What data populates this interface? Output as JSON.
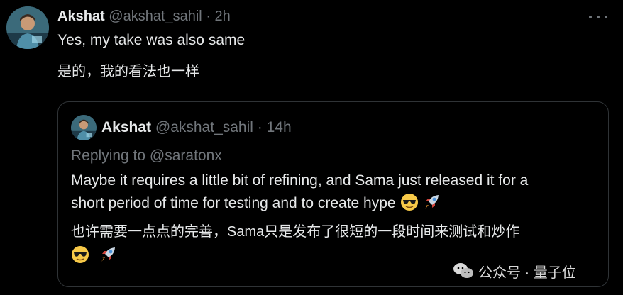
{
  "tweet": {
    "author_name": "Akshat",
    "author_handle": "@akshat_sahil",
    "separator": "·",
    "time": "2h",
    "text_en": "Yes, my take was also same",
    "text_cn": "是的，我的看法也一样",
    "avatar_icon": "avatar-icon",
    "more_icon": "more-icon"
  },
  "quoted": {
    "author_name": "Akshat",
    "author_handle": "@akshat_sahil",
    "separator": "·",
    "time": "14h",
    "replying_to": "Replying to @saratonx",
    "body_line1": "Maybe it requires a little bit of refining, and Sama just released it for a",
    "body_line2": "short period of time for testing and to create hype",
    "body_cn": "也许需要一点点的完善，Sama只是发布了很短的一段时间来测试和炒作",
    "emojis": [
      "sunglasses-emoji",
      "rocket-emoji"
    ]
  },
  "watermark": {
    "text": "公众号 · 量子位",
    "icon": "wechat-icon"
  },
  "colors": {
    "background": "#000000",
    "text": "#e7e9ea",
    "muted": "#71767b",
    "border": "#2f3336"
  }
}
